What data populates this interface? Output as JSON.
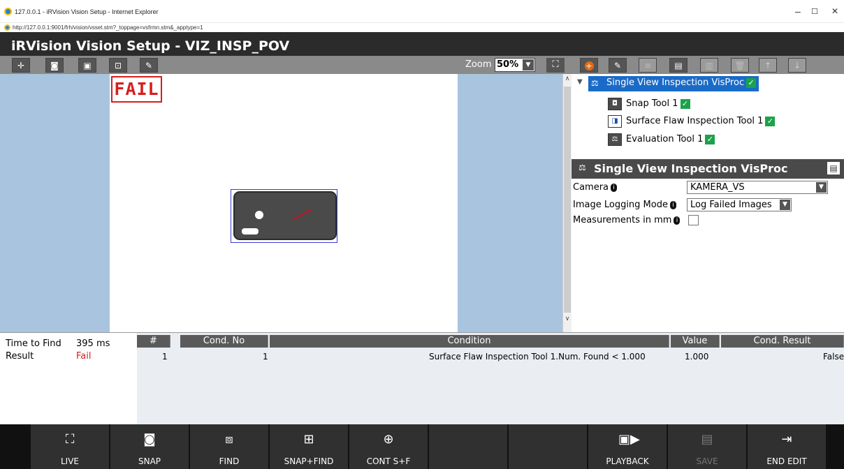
{
  "window": {
    "title": "127.0.0.1 - iRVision Vision Setup - Internet Explorer",
    "url": "http://127.0.0.1:9001/frh/vision/vsset.stm?_toppage=vsfrmn.stm&_apptype=1",
    "minimize": "–",
    "maximize": "☐",
    "close": "✕"
  },
  "app": {
    "title": "iRVision Vision Setup - VIZ_INSP_POV"
  },
  "image_toolbar": {
    "zoom_label": "Zoom",
    "zoom_value": "50%",
    "buttons": [
      "crosshair-icon",
      "camera-settings-icon",
      "save-image-icon",
      "capture-icon",
      "pen-icon"
    ]
  },
  "image": {
    "status_stamp": "FAIL"
  },
  "tree": {
    "root": {
      "label": "Single View Inspection VisProc",
      "checked": true
    },
    "items": [
      {
        "label": "Snap Tool 1",
        "checked": true,
        "icon": "camera-icon"
      },
      {
        "label": "Surface Flaw Inspection Tool 1",
        "checked": true,
        "icon": "flaw-icon"
      },
      {
        "label": "Evaluation Tool 1",
        "checked": true,
        "icon": "scale-icon"
      }
    ]
  },
  "props": {
    "title": "Single View Inspection VisProc",
    "camera_label": "Camera",
    "camera_value": "KAMERA_VS",
    "logging_label": "Image Logging Mode",
    "logging_value": "Log Failed Images",
    "mm_label": "Measurements in mm",
    "mm_checked": false
  },
  "results": {
    "time_label": "Time to Find",
    "time_value": "395 ms",
    "result_label": "Result",
    "result_value": "Fail",
    "headers": [
      "#",
      "Cond. No",
      "Condition",
      "Value",
      "Cond. Result"
    ],
    "rows": [
      {
        "num": "1",
        "cond_no": "1",
        "condition": "Surface Flaw Inspection Tool 1.Num. Found < 1.000",
        "value": "1.000",
        "result": "False"
      }
    ]
  },
  "bottom_bar": {
    "live": "LIVE",
    "snap": "SNAP",
    "find": "FIND",
    "snap_find": "SNAP+FIND",
    "cont": "CONT S+F",
    "playback": "PLAYBACK",
    "save": "SAVE",
    "end_edit": "END EDIT"
  },
  "colors": {
    "fail_red": "#d81e1e",
    "selection_blue": "#1a6bc8",
    "check_green": "#1aa34a",
    "image_bg": "#a9c4df"
  }
}
